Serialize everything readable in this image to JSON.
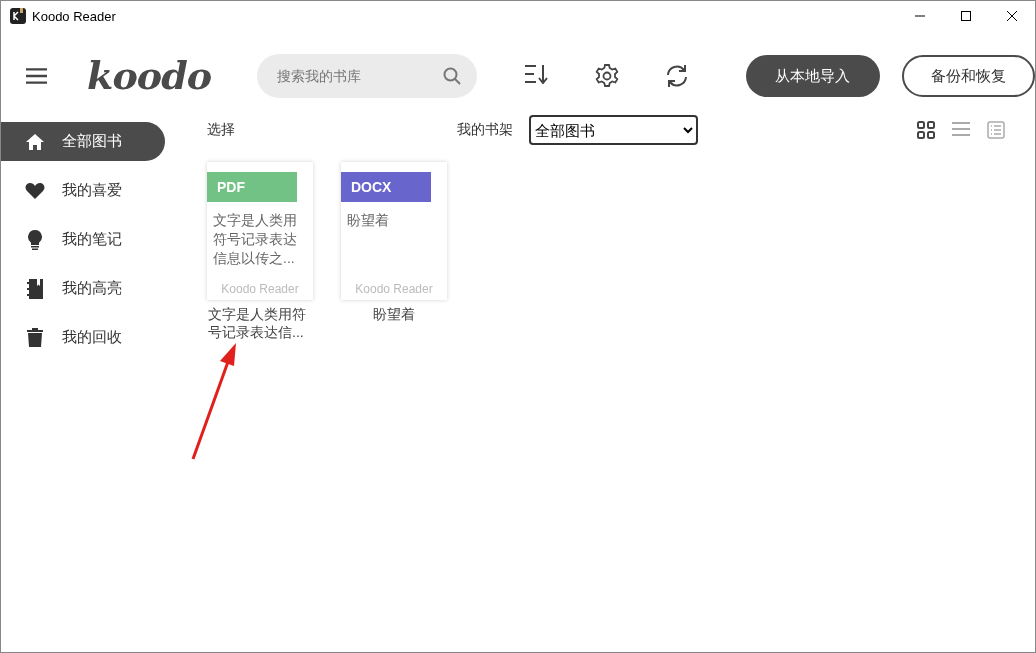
{
  "window": {
    "title": "Koodo Reader"
  },
  "header": {
    "logo": "koodo",
    "search": {
      "placeholder": "搜索我的书库"
    },
    "buttons": [
      {
        "label": "从本地导入",
        "kind": "primary"
      },
      {
        "label": "备份和恢复",
        "kind": "outline"
      }
    ]
  },
  "sidebar": {
    "items": [
      {
        "label": "全部图书",
        "kind": "home",
        "selected": true
      },
      {
        "label": "我的喜爱",
        "kind": "heart",
        "selected": false
      },
      {
        "label": "我的笔记",
        "kind": "bulb",
        "selected": false
      },
      {
        "label": "我的高亮",
        "kind": "book",
        "selected": false
      },
      {
        "label": "我的回收",
        "kind": "trash",
        "selected": false
      }
    ]
  },
  "toolbar": {
    "select_label": "选择",
    "shelf_label": "我的书架",
    "shelf_value": "全部图书",
    "view_modes": [
      {
        "kind": "grid",
        "selected": true
      },
      {
        "kind": "list",
        "selected": false
      },
      {
        "kind": "card",
        "selected": false
      }
    ]
  },
  "books": [
    {
      "format": "PDF",
      "color": "#72c285",
      "preview": "文字是人类用符号记录表达信息以传之...",
      "footer": "Koodo Reader",
      "title": "文字是人类用符号记录表达信..."
    },
    {
      "format": "DOCX",
      "color": "#6866cc",
      "preview": "盼望着",
      "footer": "Koodo Reader",
      "title": "盼望着"
    }
  ]
}
